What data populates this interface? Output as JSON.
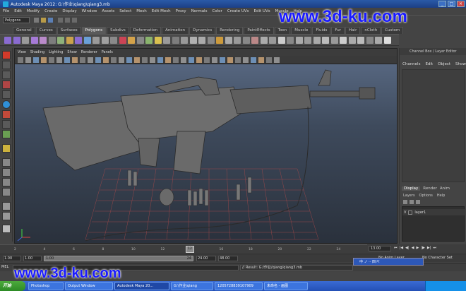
{
  "window": {
    "title": "Autodesk Maya 2012: G:\\作业\\qiang\\qiang3.mb"
  },
  "menubar": [
    "File",
    "Edit",
    "Modify",
    "Create",
    "Display",
    "Window",
    "Assets",
    "Select",
    "Mesh",
    "Edit Mesh",
    "Proxy",
    "Normals",
    "Color",
    "Create UVs",
    "Edit UVs",
    "Muscle",
    "Help"
  ],
  "statusline": {
    "mode_selector": "Polygons"
  },
  "shelf_tabs": [
    {
      "label": "General",
      "active": false
    },
    {
      "label": "Curves",
      "active": false
    },
    {
      "label": "Surfaces",
      "active": false
    },
    {
      "label": "Polygons",
      "active": true
    },
    {
      "label": "Subdivs",
      "active": false
    },
    {
      "label": "Deformation",
      "active": false
    },
    {
      "label": "Animation",
      "active": false
    },
    {
      "label": "Dynamics",
      "active": false
    },
    {
      "label": "Rendering",
      "active": false
    },
    {
      "label": "PaintEffects",
      "active": false
    },
    {
      "label": "Toon",
      "active": false
    },
    {
      "label": "Muscle",
      "active": false
    },
    {
      "label": "Fluids",
      "active": false
    },
    {
      "label": "Fur",
      "active": false
    },
    {
      "label": "Hair",
      "active": false
    },
    {
      "label": "nCloth",
      "active": false
    },
    {
      "label": "Custom",
      "active": false
    }
  ],
  "viewport_menu": [
    "View",
    "Shading",
    "Lighting",
    "Show",
    "Renderer",
    "Panels"
  ],
  "channel_box": {
    "header": "Channel Box / Layer Editor",
    "menu": [
      "Channels",
      "Edit",
      "Object",
      "Show"
    ]
  },
  "layer_editor": {
    "tabs": [
      {
        "label": "Display",
        "active": true
      },
      {
        "label": "Render",
        "active": false
      },
      {
        "label": "Anim",
        "active": false
      }
    ],
    "menu": [
      "Layers",
      "Options",
      "Help"
    ],
    "layers": [
      {
        "name": "layer1"
      }
    ]
  },
  "timeline": {
    "ticks": [
      "2",
      "4",
      "6",
      "8",
      "10",
      "12",
      "14",
      "16",
      "18",
      "20",
      "22",
      "24"
    ],
    "current_frame": "12",
    "current_time_field": "13.00"
  },
  "range": {
    "start_time": "1.00",
    "range_start": "1.00",
    "range_end": "24",
    "end_time": "24.00",
    "end_time_2": "48.00",
    "anim_layer": "No Anim Layer",
    "character_set": "No Character Set"
  },
  "command_line": {
    "label": "MEL",
    "result": "// Result: G:/作业/qiang/qiang3.mb"
  },
  "ime_bar": {
    "text": "中 ノ ·· 四 ⇱"
  },
  "taskbar": {
    "start_label": "开始",
    "tasks": [
      {
        "label": "Photoshop",
        "active": false
      },
      {
        "label": "Output Window",
        "active": false
      },
      {
        "label": "Autodesk Maya 20...",
        "active": true
      },
      {
        "label": "G:\\作业\\qiang",
        "active": false
      },
      {
        "label": "1205728839107909",
        "active": false
      },
      {
        "label": "未命名 - 画图",
        "active": false
      }
    ],
    "clock": ""
  },
  "watermarks": [
    "www.3d-ku.com",
    "www.3d-ku.com"
  ],
  "colors": {
    "titlebar": "#1c3f85",
    "ui_bg": "#444444",
    "viewport_top": "#5c6d88",
    "viewport_bottom": "#2a313c",
    "watermark": "#1a1aff",
    "taskbar": "#2450b6"
  }
}
